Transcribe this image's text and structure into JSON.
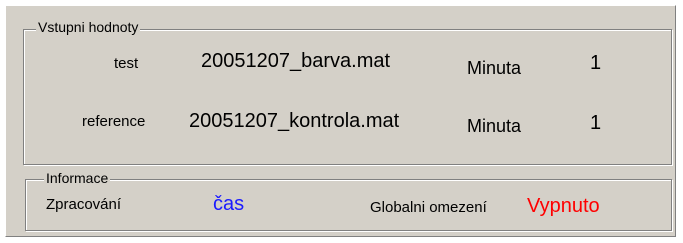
{
  "input_group": {
    "title": "Vstupni hodnoty",
    "rows": [
      {
        "label": "test",
        "file": "20051207_barva.mat",
        "unit": "Minuta",
        "value": "1"
      },
      {
        "label": "reference",
        "file": "20051207_kontrola.mat",
        "unit": "Minuta",
        "value": "1"
      }
    ]
  },
  "info_group": {
    "title": "Informace",
    "processing_label": "Zpracování",
    "processing_value": "čas",
    "global_limit_label": "Globalni omezení",
    "global_limit_value": "Vypnuto"
  },
  "colors": {
    "background": "#d4d0c8",
    "processing_value": "#1a1aff",
    "global_limit_value": "#ff0000"
  }
}
